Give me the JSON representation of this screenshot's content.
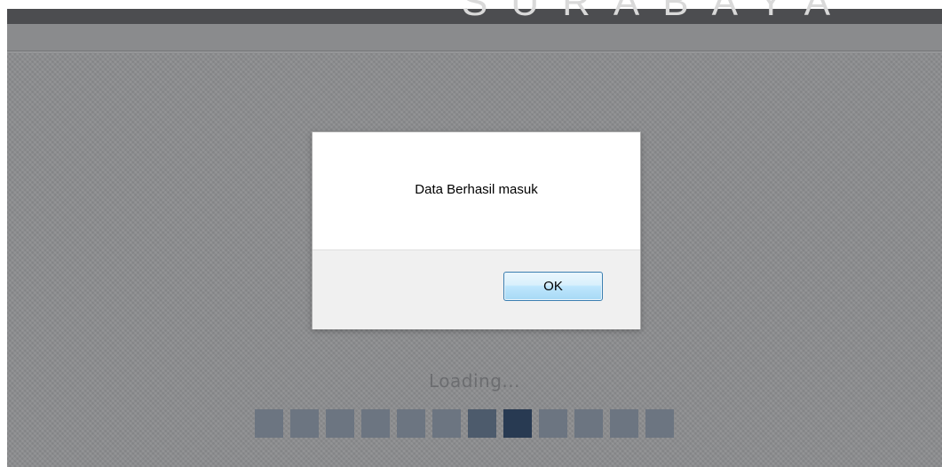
{
  "watermark": {
    "text": "SURABAYA"
  },
  "dialog": {
    "message": "Data Berhasil masuk",
    "ok_label": "OK"
  },
  "loading": {
    "label": "Loading...",
    "segment_count": 12,
    "active_segment": 8,
    "colors": {
      "segment": "#6c7581",
      "segment_mid": "#4d5b6c",
      "segment_active": "#283a52"
    }
  },
  "colors": {
    "overlay": "#8c8d8f",
    "top_strip": "#4c4d50",
    "dialog_footer": "#f0f0f0",
    "button_border": "#3c7fb1"
  }
}
